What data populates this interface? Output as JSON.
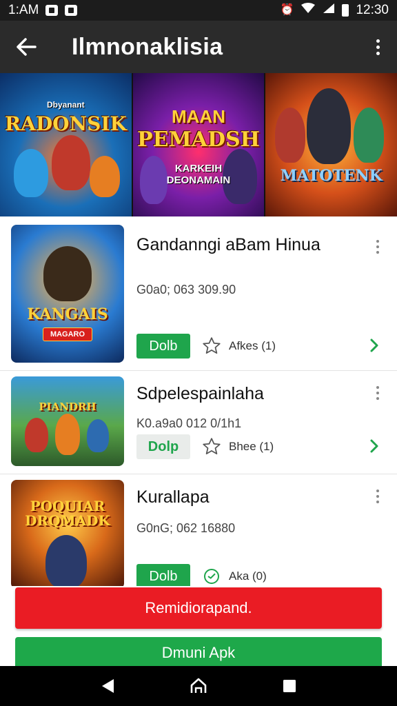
{
  "status_bar": {
    "time_left": "1:AM",
    "time_right": "12:30"
  },
  "app_bar": {
    "title": "Ilmnonaklisia"
  },
  "banners": [
    {
      "title": "RADONSIK",
      "subtitle": "Dbyanant",
      "caption": ""
    },
    {
      "title": "PEMADSH",
      "subtitle": "MAAN",
      "caption": "KARKEIH DEONAMAIN"
    },
    {
      "title": "MATOTENK",
      "subtitle": "",
      "caption": ""
    }
  ],
  "games": [
    {
      "name": "Gandanngi aBam Hinua",
      "meta": "G0a0; 063 309.90",
      "thumb_title": "KANGAIS",
      "thumb_tag": "MAGARO",
      "button": "Dolb",
      "button_style": "solid",
      "rating": "Afkes (1)"
    },
    {
      "name": "Sdpelespainlaha",
      "meta": "K0.a9a0 012 0/1h1",
      "thumb_title": "PIANDRH",
      "thumb_tag": "",
      "button": "Dolp",
      "button_style": "soft",
      "rating": "Bhee (1)"
    },
    {
      "name": "Kurallapa",
      "meta": "G0nG; 062 16880",
      "thumb_title": "POQUIAR DRQMADK",
      "thumb_tag": "",
      "button": "Dolb",
      "button_style": "solid",
      "rating": "Aka (0)"
    }
  ],
  "actions": {
    "primary": "Remidiorapand.",
    "secondary": "Dmuni Apk"
  },
  "colors": {
    "appbar": "#2b2b2b",
    "accent_green": "#1fa54c",
    "accent_red": "#ea1c24"
  }
}
